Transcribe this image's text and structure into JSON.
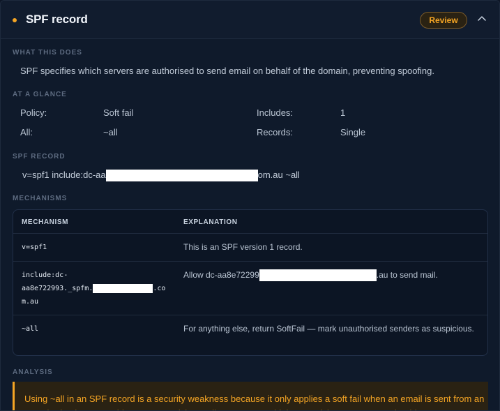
{
  "header": {
    "title": "SPF record",
    "badge": "Review",
    "status_color": "#f5a524"
  },
  "what_this_does": {
    "label": "WHAT THIS DOES",
    "text": "SPF specifies which servers are authorised to send email on behalf of the domain, preventing spoofing."
  },
  "at_a_glance": {
    "label": "AT A GLANCE",
    "items": [
      {
        "key": "Policy:",
        "value": "Soft fail"
      },
      {
        "key": "Includes:",
        "value": "1"
      },
      {
        "key": "All:",
        "value": "~all"
      },
      {
        "key": "Records:",
        "value": "Single"
      }
    ]
  },
  "spf_record": {
    "label": "SPF RECORD",
    "prefix": "v=spf1 include:dc-aa",
    "suffix": "om.au ~all"
  },
  "mechanisms": {
    "label": "MECHANISMS",
    "columns": [
      "MECHANISM",
      "EXPLANATION"
    ],
    "rows": [
      {
        "mechanism": "v=spf1",
        "explanation": "This is an SPF version 1 record."
      },
      {
        "mechanism_line1": "include:dc-",
        "mechanism_line2": "aa8e722993._spfm.",
        "mechanism_line2_suffix": ".co",
        "mechanism_line3": "m.au",
        "explanation_prefix": "Allow dc-aa8e72299",
        "explanation_suffix": ".au to send mail."
      },
      {
        "mechanism": "~all",
        "explanation": "For anything else, return SoftFail — mark unauthorised senders as suspicious."
      }
    ]
  },
  "analysis": {
    "label": "ANALYSIS",
    "text": "Using ~all in an SPF record is a security weakness because it only applies a soft fail when an email is sent from an unauthorized source. This means receiving mail servers are told that suspicious messages should"
  }
}
